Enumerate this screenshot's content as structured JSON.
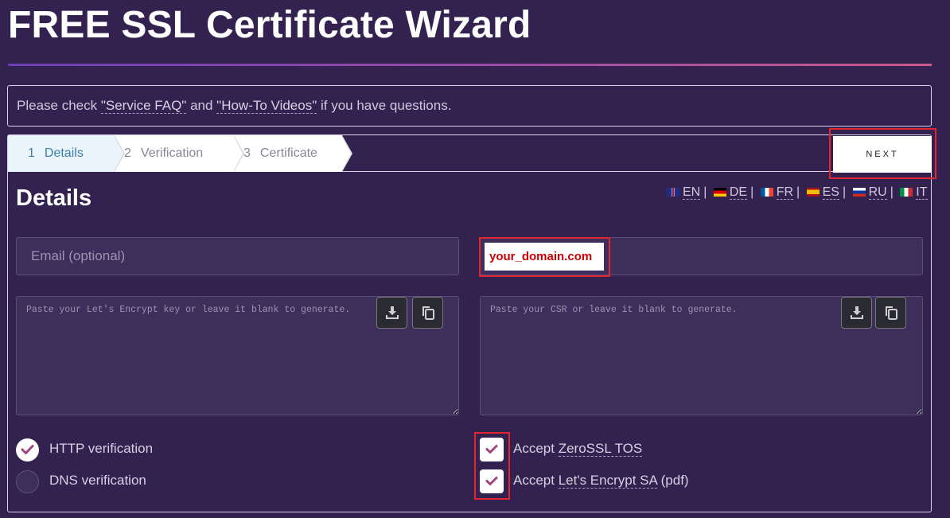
{
  "header": {
    "title": "FREE SSL Certificate Wizard"
  },
  "notice": {
    "prefix": "Please check ",
    "faq_link": "\"Service FAQ\"",
    "middle": " and ",
    "videos_link": "\"How-To Videos\"",
    "suffix": " if you have questions."
  },
  "steps": [
    {
      "num": "1",
      "label": "Details",
      "active": true
    },
    {
      "num": "2",
      "label": "Verification",
      "active": false
    },
    {
      "num": "3",
      "label": "Certificate",
      "active": false
    }
  ],
  "next_button": {
    "label": "NEXT"
  },
  "section": {
    "title": "Details"
  },
  "languages": [
    "EN",
    "DE",
    "FR",
    "ES",
    "RU",
    "IT"
  ],
  "form": {
    "email_placeholder": "Email (optional)",
    "domain_value": "your_domain.com",
    "key_placeholder": "Paste your Let's Encrypt key or leave it blank to generate.",
    "csr_placeholder": "Paste your CSR or leave it blank to generate."
  },
  "verification": {
    "http_label": "HTTP verification",
    "http_selected": true,
    "dns_label": "DNS verification",
    "dns_selected": false
  },
  "agreements": {
    "tos_prefix": "Accept ",
    "tos_link": "ZeroSSL TOS",
    "tos_checked": true,
    "le_prefix": "Accept ",
    "le_link": "Let's Encrypt SA",
    "le_suffix": " (pdf)",
    "le_checked": true
  },
  "colors": {
    "background": "#33224f",
    "highlight": "#e0262f",
    "check": "#a0457e",
    "active_step": "#3d7fa6"
  }
}
